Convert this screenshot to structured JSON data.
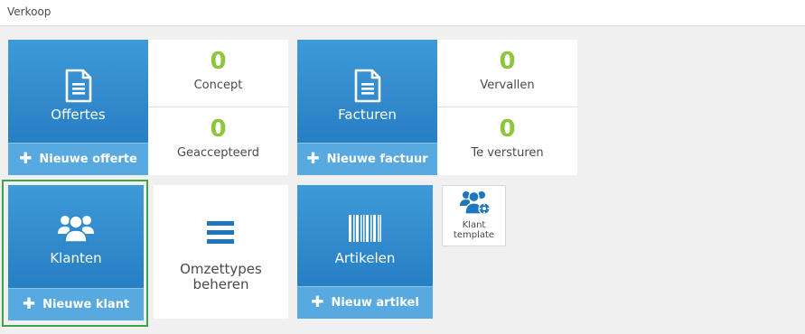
{
  "header": {
    "title": "Verkoop"
  },
  "offertes": {
    "label": "Offertes",
    "icon": "document-icon",
    "action": "Nieuwe offerte",
    "stats": [
      {
        "value": "0",
        "label": "Concept"
      },
      {
        "value": "0",
        "label": "Geaccepteerd"
      }
    ]
  },
  "facturen": {
    "label": "Facturen",
    "icon": "document-icon",
    "action": "Nieuwe factuur",
    "stats": [
      {
        "value": "0",
        "label": "Vervallen"
      },
      {
        "value": "0",
        "label": "Te versturen"
      }
    ]
  },
  "klanten": {
    "label": "Klanten",
    "icon": "users-icon",
    "action": "Nieuwe klant"
  },
  "omzettypes": {
    "label_line1": "Omzettypes",
    "label_line2": "beheren",
    "icon": "hamburger-menu-icon"
  },
  "artikelen": {
    "label": "Artikelen",
    "icon": "barcode-icon",
    "action": "Nieuw artikel"
  },
  "klant_template": {
    "label_line1": "Klant",
    "label_line2": "template",
    "icon": "users-settings-icon"
  },
  "colors": {
    "tile_blue": "#2a86c9",
    "footer_blue": "#57a9e0",
    "stat_green": "#8cc63f",
    "highlight_green": "#3fa548"
  }
}
